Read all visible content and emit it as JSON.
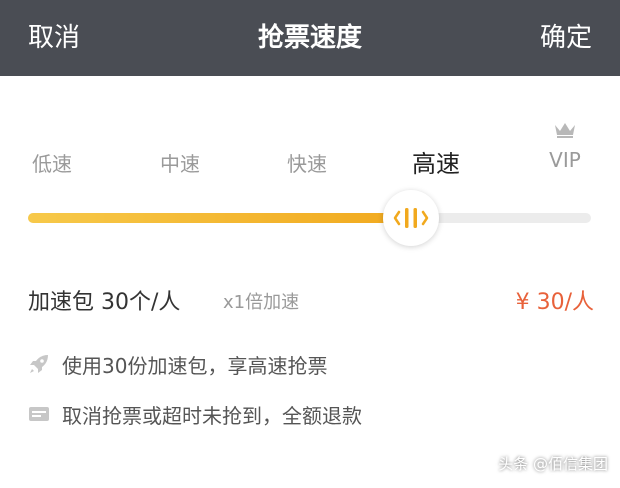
{
  "header": {
    "cancel_label": "取消",
    "title": "抢票速度",
    "confirm_label": "确定",
    "background_color": "#4a4d54"
  },
  "speed_selector": {
    "options": [
      {
        "label": "低速"
      },
      {
        "label": "中速"
      },
      {
        "label": "快速"
      },
      {
        "label": "高速"
      },
      {
        "label": "VIP",
        "icon": "crown-icon"
      }
    ],
    "selected_index": 3,
    "selected_label": "高速",
    "slider_value_fraction": 0.68,
    "accent_color": "#f1a91e"
  },
  "package": {
    "name": "加速包 30个/人",
    "multiplier": "x1倍加速",
    "price": "¥ 30/人",
    "price_color": "#e8613a"
  },
  "features": [
    {
      "icon": "rocket-icon",
      "text": "使用30份加速包，享高速抢票"
    },
    {
      "icon": "ticket-icon",
      "text": "取消抢票或超时未抢到，全额退款"
    }
  ],
  "watermark": {
    "text": "头条 @佰信集团"
  }
}
